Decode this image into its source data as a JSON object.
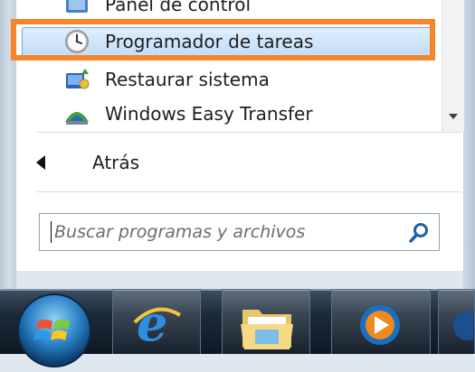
{
  "start_menu": {
    "programs": [
      {
        "label": "Panel de control",
        "icon": "control-panel-icon"
      },
      {
        "label": "Programador de tareas",
        "icon": "task-scheduler-clock-icon"
      },
      {
        "label": "Restaurar sistema",
        "icon": "system-restore-icon"
      },
      {
        "label": "Windows Easy Transfer",
        "icon": "easy-transfer-icon"
      }
    ],
    "back_label": "Atrás",
    "search": {
      "placeholder": "Buscar programas y archivos",
      "button_icon": "magnifier-icon"
    }
  },
  "taskbar": {
    "items": [
      {
        "icon": "windows-start-orb-icon"
      },
      {
        "icon": "internet-explorer-icon"
      },
      {
        "icon": "windows-explorer-folder-icon"
      },
      {
        "icon": "windows-media-player-icon"
      }
    ]
  },
  "colors": {
    "highlight_frame": "#f4852a",
    "selection": "#c3dcf7",
    "taskbar": "#1c2a38"
  }
}
